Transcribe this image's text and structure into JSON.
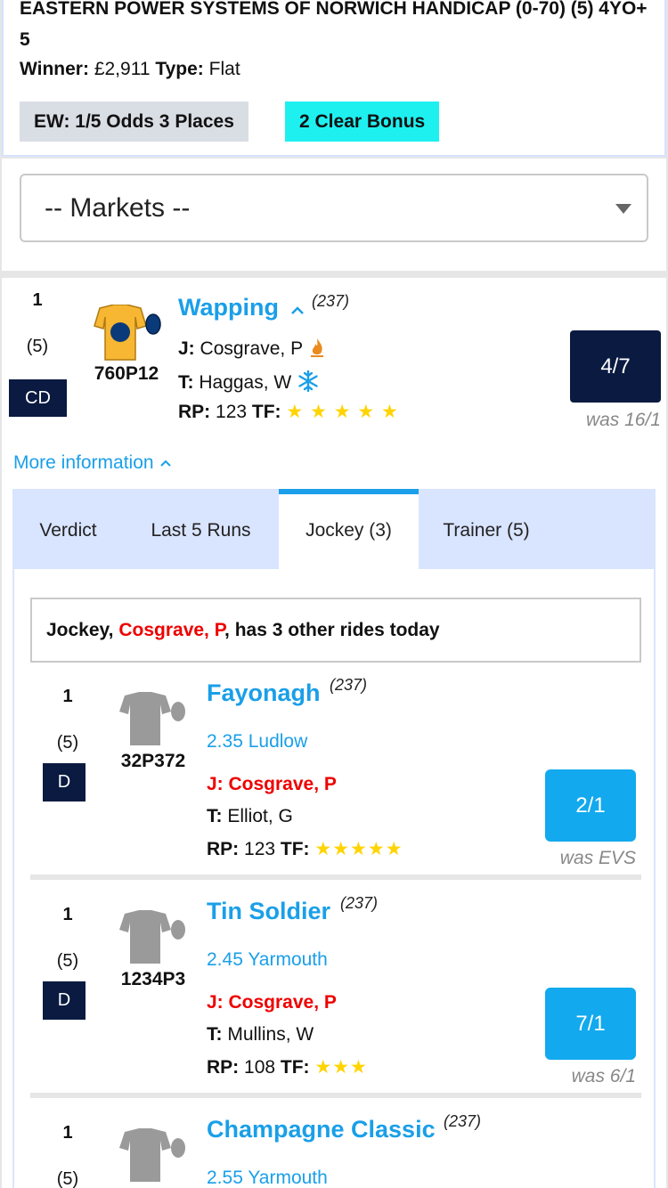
{
  "race": {
    "title": "EASTERN POWER SYSTEMS OF NORWICH HANDICAP (0-70) (5) 4YO+ 5",
    "winner_label": "Winner:",
    "winner_value": "£2,911",
    "type_label": "Type:",
    "type_value": "Flat",
    "ew_badge": "EW: 1/5 Odds 3 Places",
    "bonus_badge": "2 Clear Bonus"
  },
  "markets": {
    "label": "-- Markets --"
  },
  "runner": {
    "number": "1",
    "draw": "(5)",
    "badge": "CD",
    "form": "760P12",
    "name": "Wapping",
    "rating": "(237)",
    "jockey_label": "J:",
    "jockey": "Cosgrave, P",
    "trainer_label": "T:",
    "trainer": "Haggas, W",
    "rp_label": "RP:",
    "rp": "123",
    "tf_label": "TF:",
    "tf_stars": "★ ★ ★ ★ ★",
    "odds": "4/7",
    "was": "was 16/1",
    "silk_colors": {
      "body": "#f7b733",
      "cap": "#0a3a7a",
      "spot": "#0a3a7a"
    }
  },
  "more_info": "More information",
  "tabs": [
    {
      "label": "Verdict"
    },
    {
      "label": "Last 5 Runs"
    },
    {
      "label": "Jockey (3)"
    },
    {
      "label": "Trainer (5)"
    }
  ],
  "notice": {
    "prefix": "Jockey, ",
    "name": "Cosgrave, P",
    "suffix": ", has 3 other rides today"
  },
  "rides": [
    {
      "number": "1",
      "draw": "(5)",
      "badge": "D",
      "form": "32P372",
      "name": "Fayonagh",
      "rating": "(237)",
      "venue": "2.35 Ludlow",
      "jockey": "J: Cosgrave, P",
      "trainer_label": "T:",
      "trainer": "Elliot, G",
      "rp_label": "RP:",
      "rp": "123",
      "tf_label": "TF:",
      "tf_stars": "★★★★★",
      "odds": "2/1",
      "was": "was EVS"
    },
    {
      "number": "1",
      "draw": "(5)",
      "badge": "D",
      "form": "1234P3",
      "name": "Tin Soldier",
      "rating": "(237)",
      "venue": "2.45 Yarmouth",
      "jockey": "J: Cosgrave, P",
      "trainer_label": "T:",
      "trainer": "Mullins, W",
      "rp_label": "RP:",
      "rp": "108",
      "tf_label": "TF:",
      "tf_stars": "★★★",
      "odds": "7/1",
      "was": "was 6/1"
    },
    {
      "number": "1",
      "draw": "(5)",
      "name": "Champagne Classic",
      "rating": "(237)",
      "venue": "2.55 Yarmouth"
    }
  ]
}
